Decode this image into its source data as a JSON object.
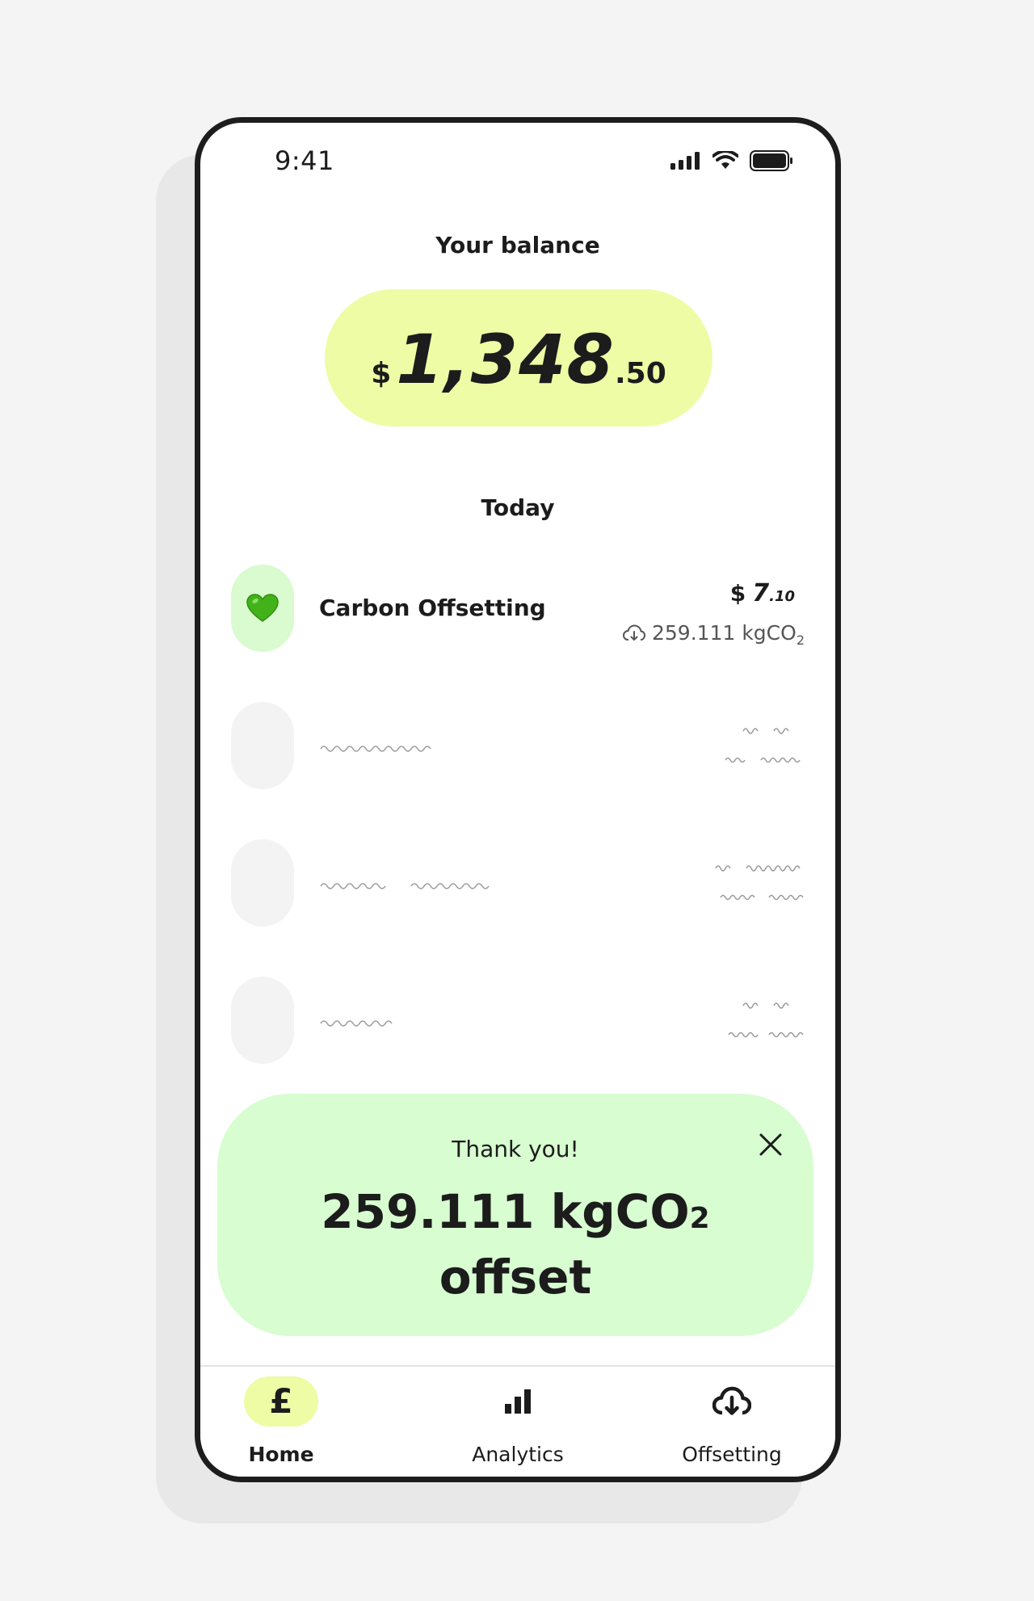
{
  "status_bar": {
    "time": "9:41"
  },
  "balance": {
    "label": "Your balance",
    "currency": "$",
    "whole": "1,348",
    "cents": ".50"
  },
  "transactions": {
    "section_label": "Today",
    "items": [
      {
        "name": "Carbon Offsetting",
        "icon": "green-heart-icon",
        "amount_currency": "$",
        "amount_whole": "7",
        "amount_cents": ".10",
        "co2_value": "259.111 kgCO",
        "co2_sub": "2"
      }
    ]
  },
  "toast": {
    "title": "Thank you!",
    "value_main": "259.111 kgCO",
    "value_sub": "2",
    "value_suffix": "offset"
  },
  "tabs": [
    {
      "label": "Home",
      "icon": "pound-icon",
      "active": true,
      "glyph": "£"
    },
    {
      "label": "Analytics",
      "icon": "bar-chart-icon",
      "active": false
    },
    {
      "label": "Offsetting",
      "icon": "cloud-download-icon",
      "active": false
    }
  ],
  "colors": {
    "background": "#f4f4f4",
    "balance_pill": "#eefca5",
    "toast": "#d7fdd0",
    "active_icon_bg": "#d9fbcf",
    "placeholder": "#f3f3f3",
    "text": "#1c1c1c"
  }
}
